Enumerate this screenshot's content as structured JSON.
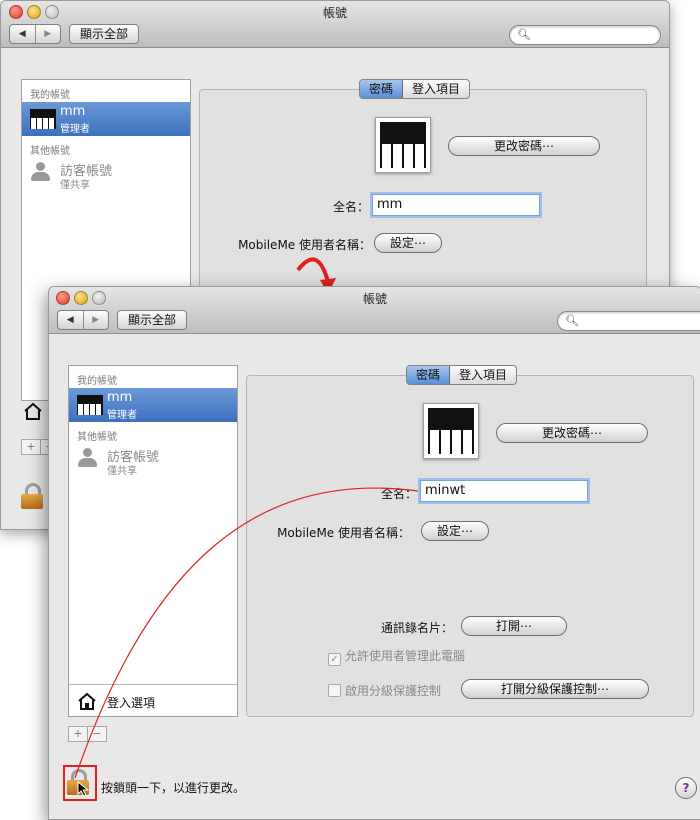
{
  "back_window": {
    "title": "帳號",
    "nav": {
      "back": "◀",
      "forward": "▶"
    },
    "show_all": "顯示全部",
    "sidebar": {
      "my_accounts_header": "我的帳號",
      "user_name": "mm",
      "user_role": "管理者",
      "other_accounts_header": "其他帳號",
      "guest_name": "訪客帳號",
      "guest_role": "僅共享"
    },
    "tabs": {
      "password": "密碼",
      "login_items": "登入項目"
    },
    "change_password": "更改密碼⋯",
    "full_name_label": "全名：",
    "full_name_value": "mm",
    "mobileme_label": "MobileMe 使用者名稱：",
    "setup_button": "設定⋯",
    "plus": "+",
    "minus": "−"
  },
  "front_window": {
    "title": "帳號",
    "nav": {
      "back": "◀",
      "forward": "▶"
    },
    "show_all": "顯示全部",
    "sidebar": {
      "my_accounts_header": "我的帳號",
      "user_name": "mm",
      "user_role": "管理者",
      "other_accounts_header": "其他帳號",
      "guest_name": "訪客帳號",
      "guest_role": "僅共享",
      "login_options": "登入選項"
    },
    "tabs": {
      "password": "密碼",
      "login_items": "登入項目"
    },
    "change_password": "更改密碼⋯",
    "full_name_label": "全名：",
    "full_name_value": "minwt",
    "mobileme_label": "MobileMe 使用者名稱：",
    "setup_button": "設定⋯",
    "address_card_label": "通訊錄名片：",
    "open_button": "打開⋯",
    "allow_admin": "允許使用者管理此電腦",
    "enable_parental": "啟用分級保護控制",
    "open_parental_button": "打開分級保護控制⋯",
    "plus": "+",
    "minus": "−",
    "lock_message": "按鎖頭一下，以進行更改。",
    "help": "?"
  },
  "colors": {
    "selection": "#3d6fbd",
    "annotation": "#e02020"
  }
}
